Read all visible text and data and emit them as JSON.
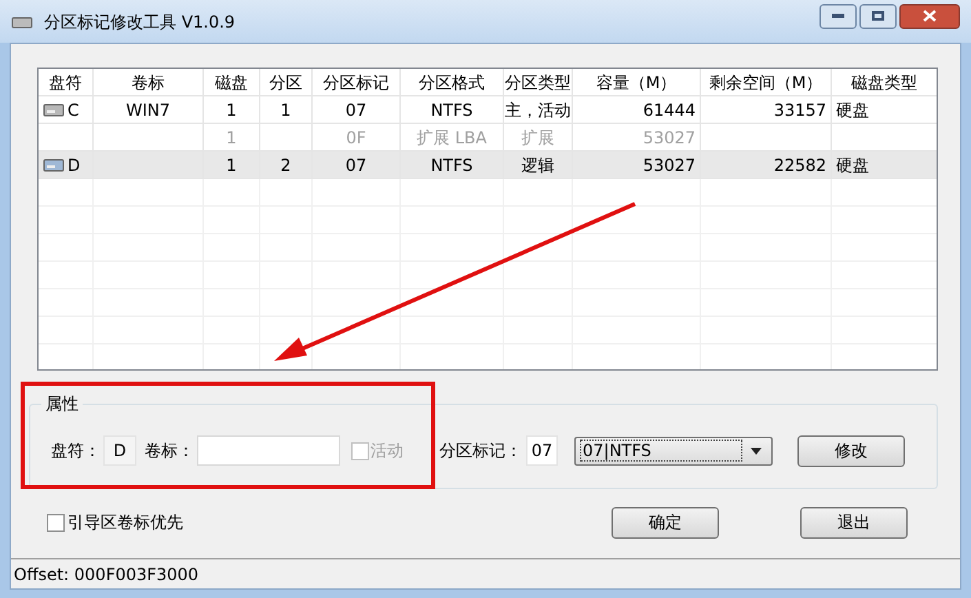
{
  "window": {
    "title": "分区标记修改工具 V1.0.9"
  },
  "table": {
    "columns": [
      "盘符",
      "卷标",
      "磁盘",
      "分区",
      "分区标记",
      "分区格式",
      "分区类型",
      "容量（M）",
      "剩余空间（M）",
      "磁盘类型"
    ],
    "rows": [
      {
        "kind": "partition",
        "selected": false,
        "cells": [
          "C",
          "WIN7",
          "1",
          "1",
          "07",
          "NTFS",
          "主，活动",
          "61444",
          "33157",
          "硬盘"
        ]
      },
      {
        "kind": "extended",
        "selected": false,
        "cells": [
          null,
          null,
          "1",
          null,
          "0F",
          "扩展 LBA",
          "扩展",
          "53027",
          null,
          null
        ]
      },
      {
        "kind": "partition",
        "selected": true,
        "cells": [
          "D",
          null,
          "1",
          "2",
          "07",
          "NTFS",
          "逻辑",
          "53027",
          "22582",
          "硬盘"
        ]
      }
    ]
  },
  "properties": {
    "title": "属性",
    "drive_label": "盘符：",
    "drive": "D",
    "volume_label": "卷标：",
    "active": {
      "label": "活动",
      "checked": false,
      "disabled": true
    },
    "mark_label": "分区标记：",
    "mark_value": "07",
    "format_select": "07|NTFS",
    "modify_button": "修改"
  },
  "boot_option": {
    "label": "引导区卷标优先",
    "checked": false
  },
  "buttons": [
    "确定",
    "退出"
  ],
  "status_bar": "Offset: 000F003F3000"
}
